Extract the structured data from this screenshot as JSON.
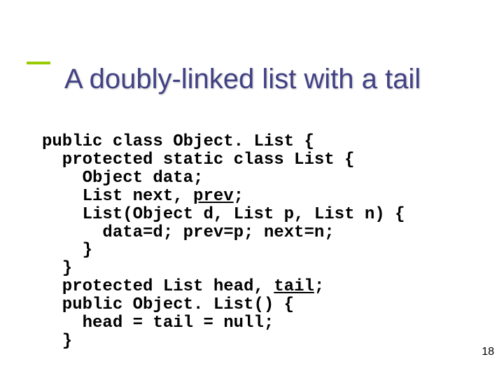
{
  "slide": {
    "title": "A doubly-linked list with a tail",
    "page_number": "18"
  },
  "code": {
    "l1": "public class Object. List {",
    "l2": "  protected static class List {",
    "l3": "    Object data;",
    "l4a": "    List next, ",
    "l4b": "prev",
    "l4c": ";",
    "l5": "    List(Object d, List p, List n) {",
    "l6": "      data=d; prev=p; next=n;",
    "l7": "    }",
    "l8": "  }",
    "l9a": "  protected List head, ",
    "l9b": "tail",
    "l9c": ";",
    "l10": "  public Object. List() {",
    "l11": "    head = tail = null;",
    "l12": "  }"
  }
}
